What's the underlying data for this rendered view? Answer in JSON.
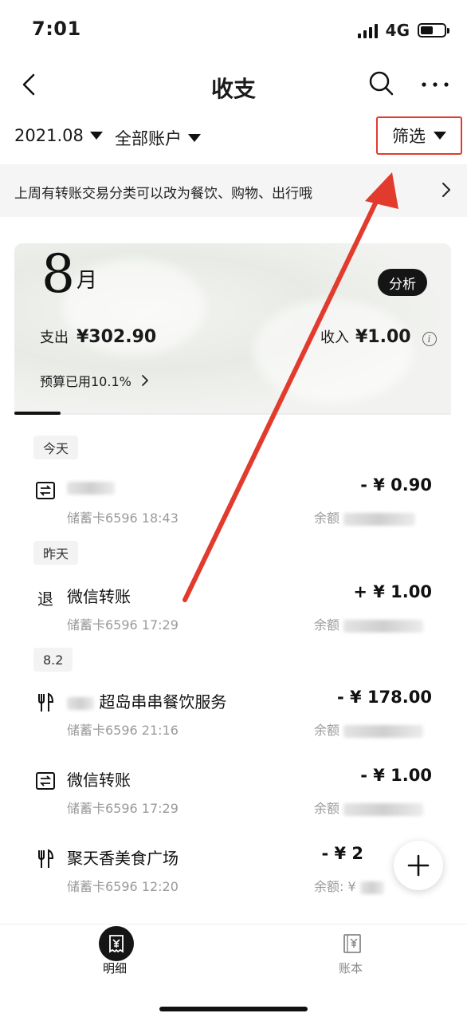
{
  "status_bar": {
    "time": "7:01",
    "network": "4G"
  },
  "nav": {
    "title": "收支"
  },
  "filters": {
    "month": "2021.08",
    "account": "全部账户",
    "filter_label": "筛选"
  },
  "tip": {
    "text": "上周有转账交易分类可以改为餐饮、购物、出行哦"
  },
  "summary": {
    "month_number": "8",
    "month_unit": "月",
    "analyze_label": "分析",
    "expense_label": "支出",
    "expense_amount": "¥302.90",
    "income_label": "收入",
    "income_amount": "¥1.00",
    "budget_text": "预算已用10.1%"
  },
  "groups": [
    {
      "date_label": "今天"
    },
    {
      "date_label": "昨天"
    },
    {
      "date_label": "8.2"
    }
  ],
  "transactions": [
    {
      "icon": "transfer-icon",
      "glyph": "⇄",
      "title": "",
      "account": "储蓄卡6596 18:43",
      "amount": "- ¥ 0.90",
      "balance_label": "余额"
    },
    {
      "icon": "refund-icon",
      "glyph": "退",
      "title": "微信转账",
      "account": "储蓄卡6596 17:29",
      "amount": "+ ¥ 1.00",
      "balance_label": "余额"
    },
    {
      "icon": "dining-icon",
      "glyph": "",
      "title": "超岛串串餐饮服务",
      "account": "储蓄卡6596 21:16",
      "amount": "- ¥ 178.00",
      "balance_label": "余额"
    },
    {
      "icon": "transfer-icon",
      "glyph": "⇄",
      "title": "微信转账",
      "account": "储蓄卡6596 17:29",
      "amount": "- ¥ 1.00",
      "balance_label": "余额"
    },
    {
      "icon": "dining-icon",
      "glyph": "",
      "title": "聚天香美食广场",
      "account": "储蓄卡6596 12:20",
      "amount": "- ¥ 2",
      "balance_label": "余额: ¥"
    }
  ],
  "tabs": [
    {
      "label": "明细",
      "icon": "receipt-icon",
      "active": true
    },
    {
      "label": "账本",
      "icon": "ledger-icon",
      "active": false
    }
  ],
  "colors": {
    "accent_red": "#e23b2e",
    "dark": "#151515",
    "muted": "#9a9a9a",
    "tip_bg": "#f5f5f5"
  }
}
